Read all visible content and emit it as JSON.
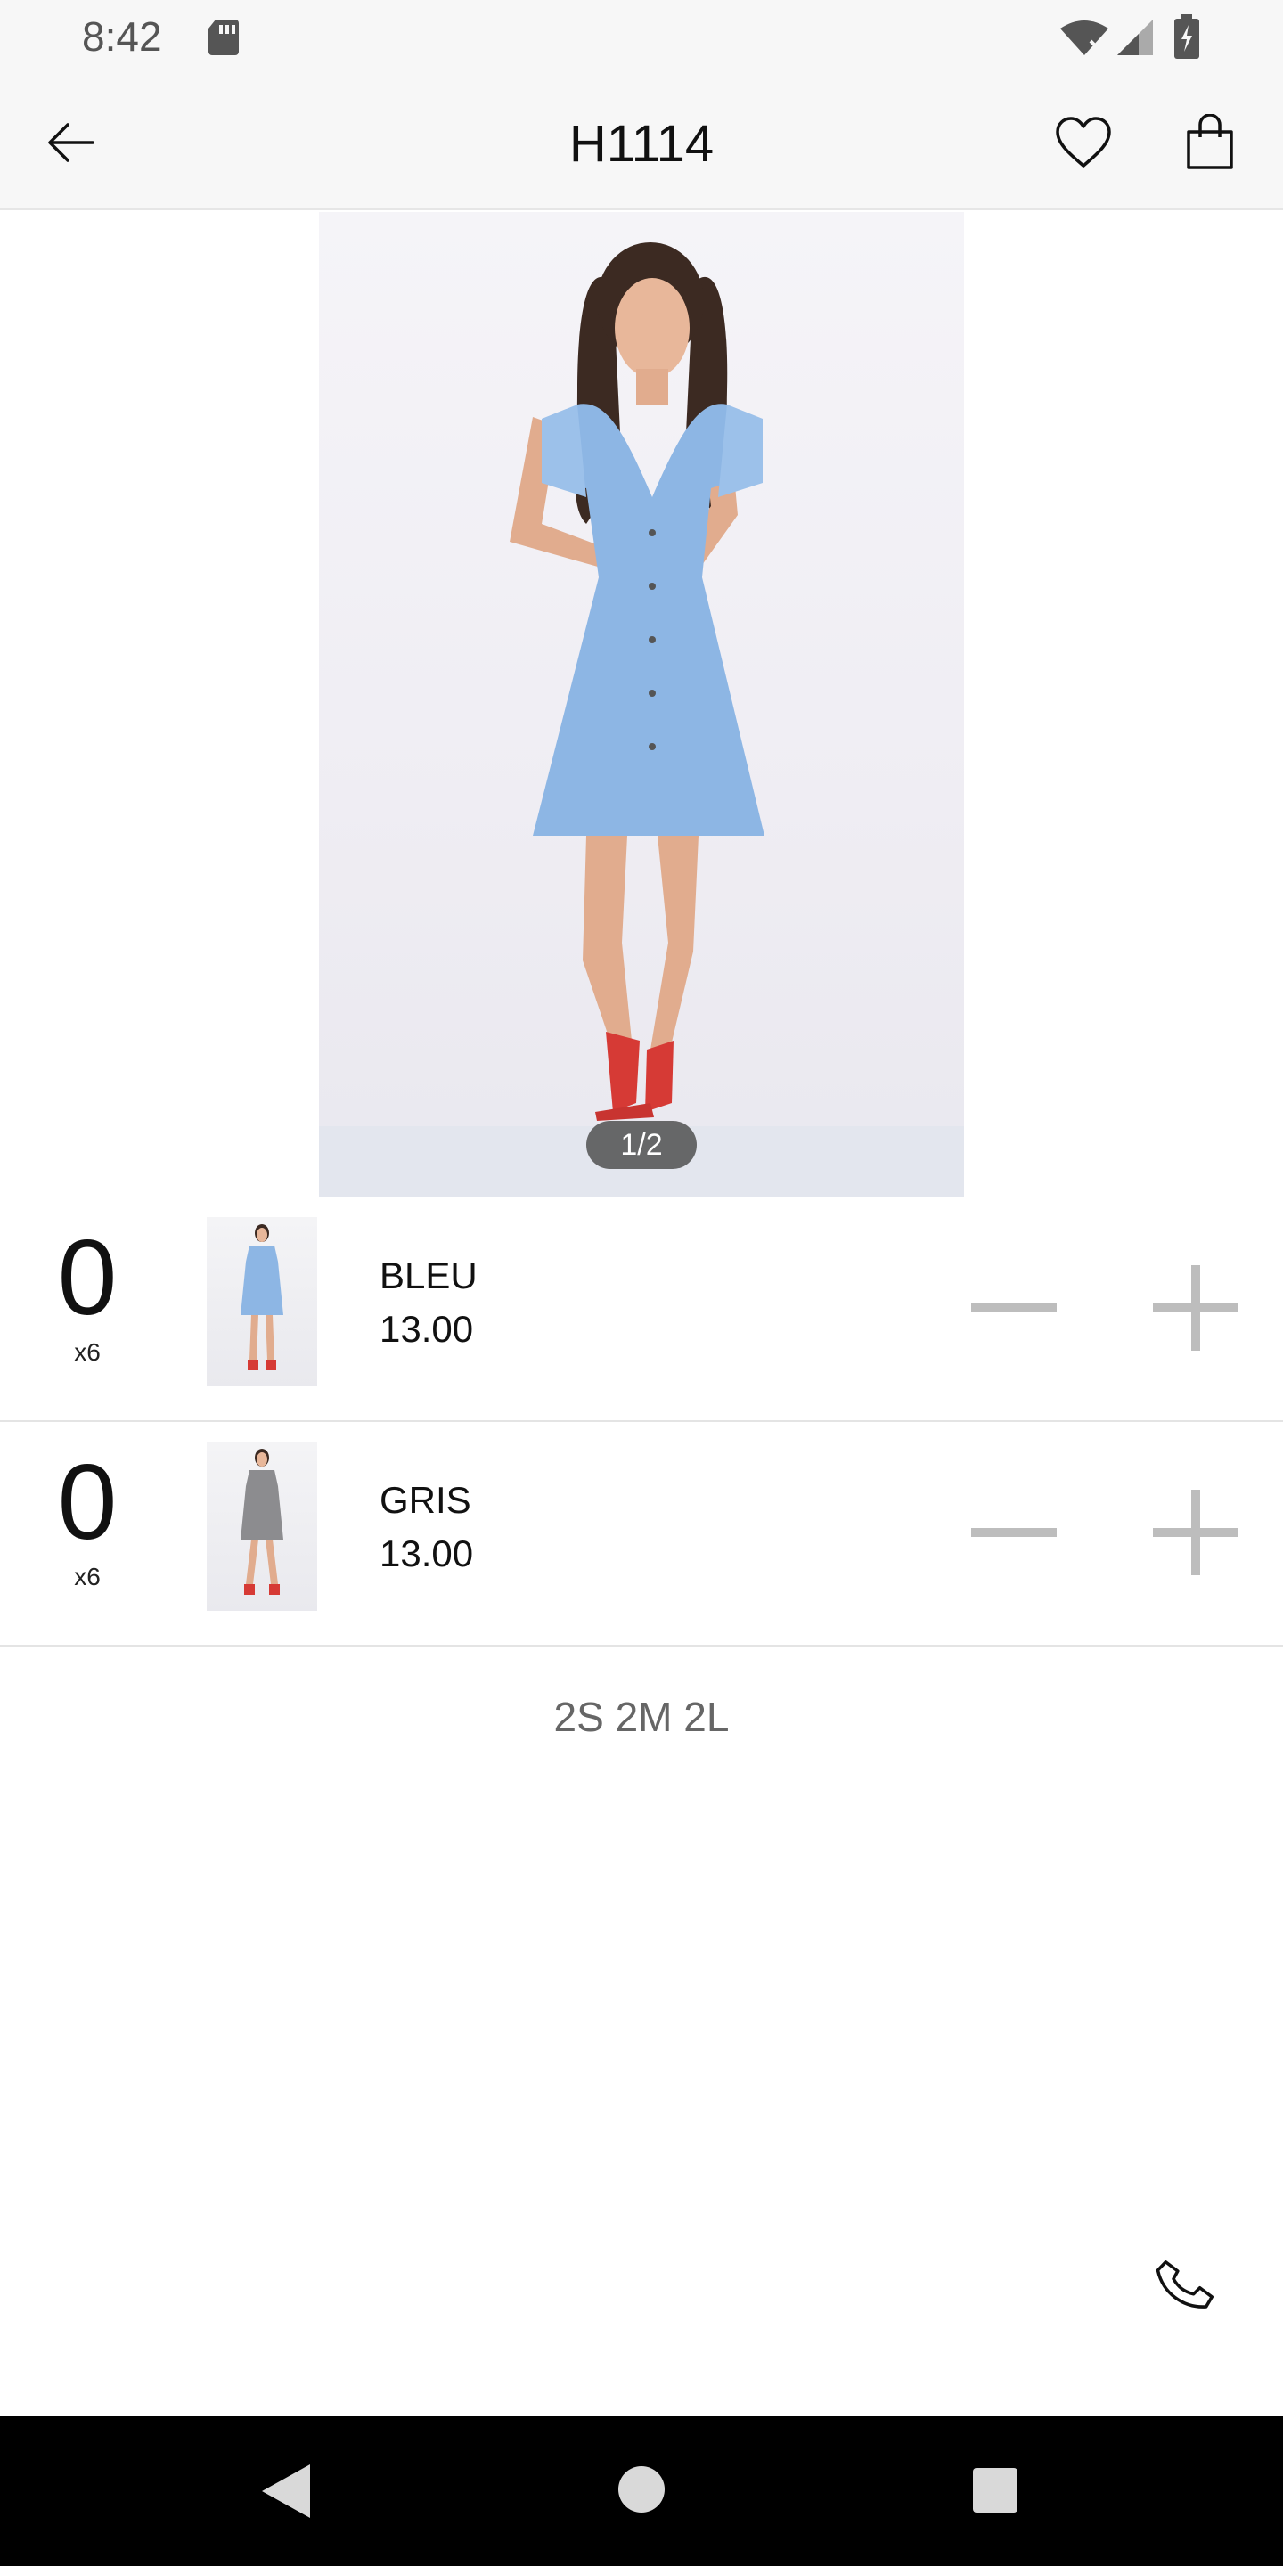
{
  "status_bar": {
    "time": "8:42",
    "icons": [
      "sd-card-icon",
      "wifi-icon",
      "signal-icon",
      "battery-icon"
    ]
  },
  "app_bar": {
    "title": "H1114",
    "icons": [
      "back-arrow-icon",
      "heart-icon",
      "shopping-bag-icon"
    ]
  },
  "gallery": {
    "pager": "1/2"
  },
  "variants": [
    {
      "quantity": "0",
      "multiplier": "x6",
      "color": "BLEU",
      "price": "13.00",
      "dress_color": "#8db6e4"
    },
    {
      "quantity": "0",
      "multiplier": "x6",
      "color": "GRIS",
      "price": "13.00",
      "dress_color": "#8c8c8f"
    }
  ],
  "sizes": "2S 2M 2L",
  "colors": {
    "accent_gray": "#bdbdbd",
    "dress_blue": "#8db6e4",
    "shoes_red": "#d63a35"
  },
  "actions": {
    "call_icon": "phone-icon"
  },
  "nav_bar": {
    "icons": [
      "nav-back-icon",
      "nav-home-icon",
      "nav-recents-icon"
    ]
  }
}
